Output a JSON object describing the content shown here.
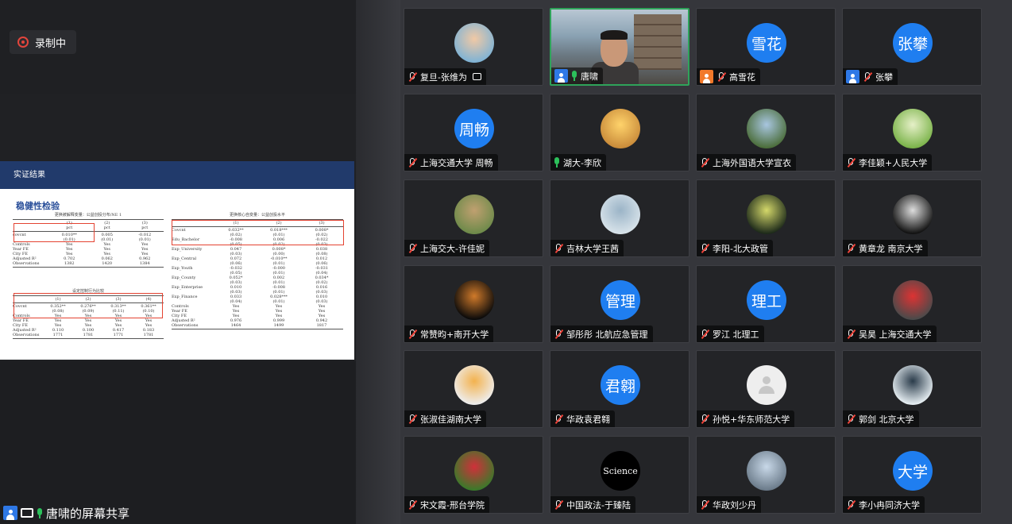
{
  "recording": {
    "label": "录制中"
  },
  "slide": {
    "header": "实证结果",
    "subtitle": "稳健性检验",
    "table1_caption": "更换被解释变量：公益创投分布/NE 1",
    "table2_caption": "更换核心自变量：公益创投水平",
    "table3_caption": "设定控制行为比较"
  },
  "share_footer": {
    "name": "唐啸的屏幕共享"
  },
  "participants": [
    {
      "name": "复旦-张维为",
      "avatar_text": "",
      "avatar": "photo",
      "muted": true,
      "badge": "",
      "extra_icon": "screenshot-icon"
    },
    {
      "name": "唐啸",
      "avatar_text": "",
      "avatar": "video",
      "muted": false,
      "badge": "blue",
      "active": true
    },
    {
      "name": "高雪花",
      "avatar_text": "雪花",
      "avatar": "blue",
      "muted": true,
      "badge": "orange"
    },
    {
      "name": "张攀",
      "avatar_text": "张攀",
      "avatar": "blue",
      "muted": true,
      "badge": "blue"
    },
    {
      "name": "上海交通大学 周畅",
      "avatar_text": "周畅",
      "avatar": "blue",
      "muted": true,
      "badge": ""
    },
    {
      "name": "湖大-李欣",
      "avatar_text": "",
      "avatar": "photo",
      "muted": false,
      "badge": ""
    },
    {
      "name": "上海外国语大学宣衣",
      "avatar_text": "",
      "avatar": "photo",
      "muted": true,
      "badge": ""
    },
    {
      "name": "李佳颖+人民大学",
      "avatar_text": "",
      "avatar": "photo",
      "muted": true,
      "badge": ""
    },
    {
      "name": "上海交大-许佳妮",
      "avatar_text": "",
      "avatar": "photo",
      "muted": true,
      "badge": ""
    },
    {
      "name": "吉林大学王茜",
      "avatar_text": "",
      "avatar": "photo",
      "muted": true,
      "badge": ""
    },
    {
      "name": "李阳-北大政管",
      "avatar_text": "",
      "avatar": "photo",
      "muted": true,
      "badge": ""
    },
    {
      "name": "黄章龙 南京大学",
      "avatar_text": "",
      "avatar": "photo",
      "muted": true,
      "badge": ""
    },
    {
      "name": "常赞昀+南开大学",
      "avatar_text": "",
      "avatar": "photo",
      "muted": true,
      "badge": ""
    },
    {
      "name": "邹彤彤 北航应急管理",
      "avatar_text": "管理",
      "avatar": "blue",
      "muted": true,
      "badge": ""
    },
    {
      "name": "罗江 北理工",
      "avatar_text": "理工",
      "avatar": "blue",
      "muted": true,
      "badge": ""
    },
    {
      "name": "吴昊 上海交通大学",
      "avatar_text": "",
      "avatar": "photo",
      "muted": true,
      "badge": ""
    },
    {
      "name": "张淑佳湖南大学",
      "avatar_text": "",
      "avatar": "photo",
      "muted": true,
      "badge": ""
    },
    {
      "name": "华政袁君翱",
      "avatar_text": "君翱",
      "avatar": "blue",
      "muted": true,
      "badge": ""
    },
    {
      "name": "孙悦+华东师范大学",
      "avatar_text": "",
      "avatar": "default",
      "muted": true,
      "badge": ""
    },
    {
      "name": "郭剑 北京大学",
      "avatar_text": "",
      "avatar": "photo",
      "muted": true,
      "badge": ""
    },
    {
      "name": "宋文霞-邢台学院",
      "avatar_text": "",
      "avatar": "photo",
      "muted": true,
      "badge": ""
    },
    {
      "name": "中国政法-于臻陆",
      "avatar_text": "Science",
      "avatar": "science",
      "muted": true,
      "badge": ""
    },
    {
      "name": "华政刘少丹",
      "avatar_text": "",
      "avatar": "photo",
      "muted": true,
      "badge": ""
    },
    {
      "name": "李小冉同济大学",
      "avatar_text": "大学",
      "avatar": "blue",
      "muted": true,
      "badge": ""
    }
  ],
  "colors": {
    "accent_blue": "#1f7ef0",
    "active_border": "#2fa35a",
    "mute_red": "#f0443a"
  }
}
